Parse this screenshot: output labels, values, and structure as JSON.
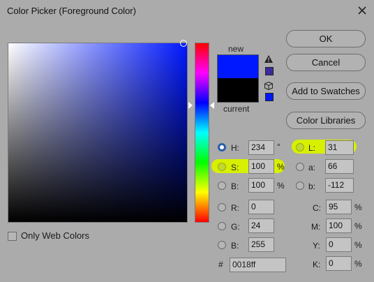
{
  "window": {
    "title": "Color Picker (Foreground Color)"
  },
  "buttons": {
    "ok": "OK",
    "cancel": "Cancel",
    "add_to_swatches": "Add to Swatches",
    "color_libraries": "Color Libraries"
  },
  "preview": {
    "new_label": "new",
    "current_label": "current",
    "new_color": "#0018ff",
    "current_color": "#000000"
  },
  "hsb": {
    "h": {
      "label": "H:",
      "value": "234",
      "unit": "°"
    },
    "s": {
      "label": "S:",
      "value": "100",
      "unit": "%"
    },
    "b": {
      "label": "B:",
      "value": "100",
      "unit": "%"
    }
  },
  "rgb": {
    "r": {
      "label": "R:",
      "value": "0"
    },
    "g": {
      "label": "G:",
      "value": "24"
    },
    "b": {
      "label": "B:",
      "value": "255"
    }
  },
  "lab": {
    "l": {
      "label": "L:",
      "value": "31"
    },
    "a": {
      "label": "a:",
      "value": "66"
    },
    "b": {
      "label": "b:",
      "value": "-112"
    }
  },
  "cmyk": {
    "c": {
      "label": "C:",
      "value": "95",
      "unit": "%"
    },
    "m": {
      "label": "M:",
      "value": "100",
      "unit": "%"
    },
    "y": {
      "label": "Y:",
      "value": "0",
      "unit": "%"
    },
    "k": {
      "label": "K:",
      "value": "0",
      "unit": "%"
    }
  },
  "hex": {
    "label": "#",
    "value": "0018ff"
  },
  "only_web_colors": {
    "label": "Only Web Colors",
    "checked": false
  },
  "colors": {
    "dialog_bg": "#ababab",
    "highlight": "#d7ef00",
    "selected_radio": "#2a5ea8"
  }
}
